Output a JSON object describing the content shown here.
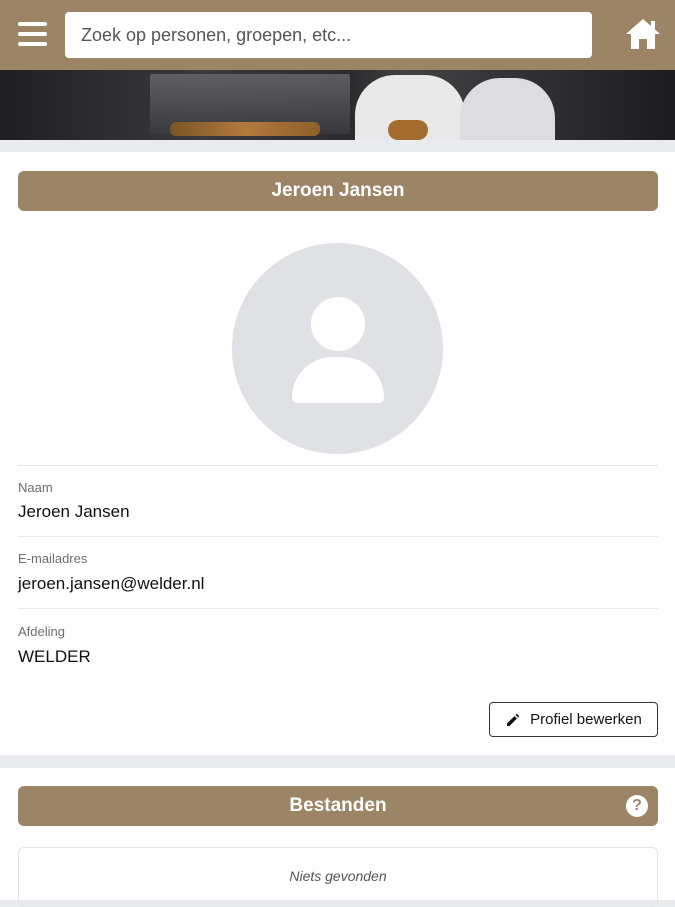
{
  "topbar": {
    "search_placeholder": "Zoek op personen, groepen, etc...",
    "menu_icon": "hamburger-menu-icon",
    "home_icon": "home-icon",
    "background_color": "#9c8467"
  },
  "profile": {
    "header": "Jeroen Jansen",
    "avatar_icon": "user-placeholder-icon",
    "fields": [
      {
        "label": "Naam",
        "value": "Jeroen Jansen"
      },
      {
        "label": "E-mailadres",
        "value": "jeroen.jansen@welder.nl"
      },
      {
        "label": "Afdeling",
        "value": "WELDER"
      }
    ],
    "edit_button": "Profiel bewerken",
    "edit_icon": "pencil-icon"
  },
  "files": {
    "header": "Bestanden",
    "help_icon": "question-circle-icon",
    "empty_text": "Niets gevonden"
  }
}
